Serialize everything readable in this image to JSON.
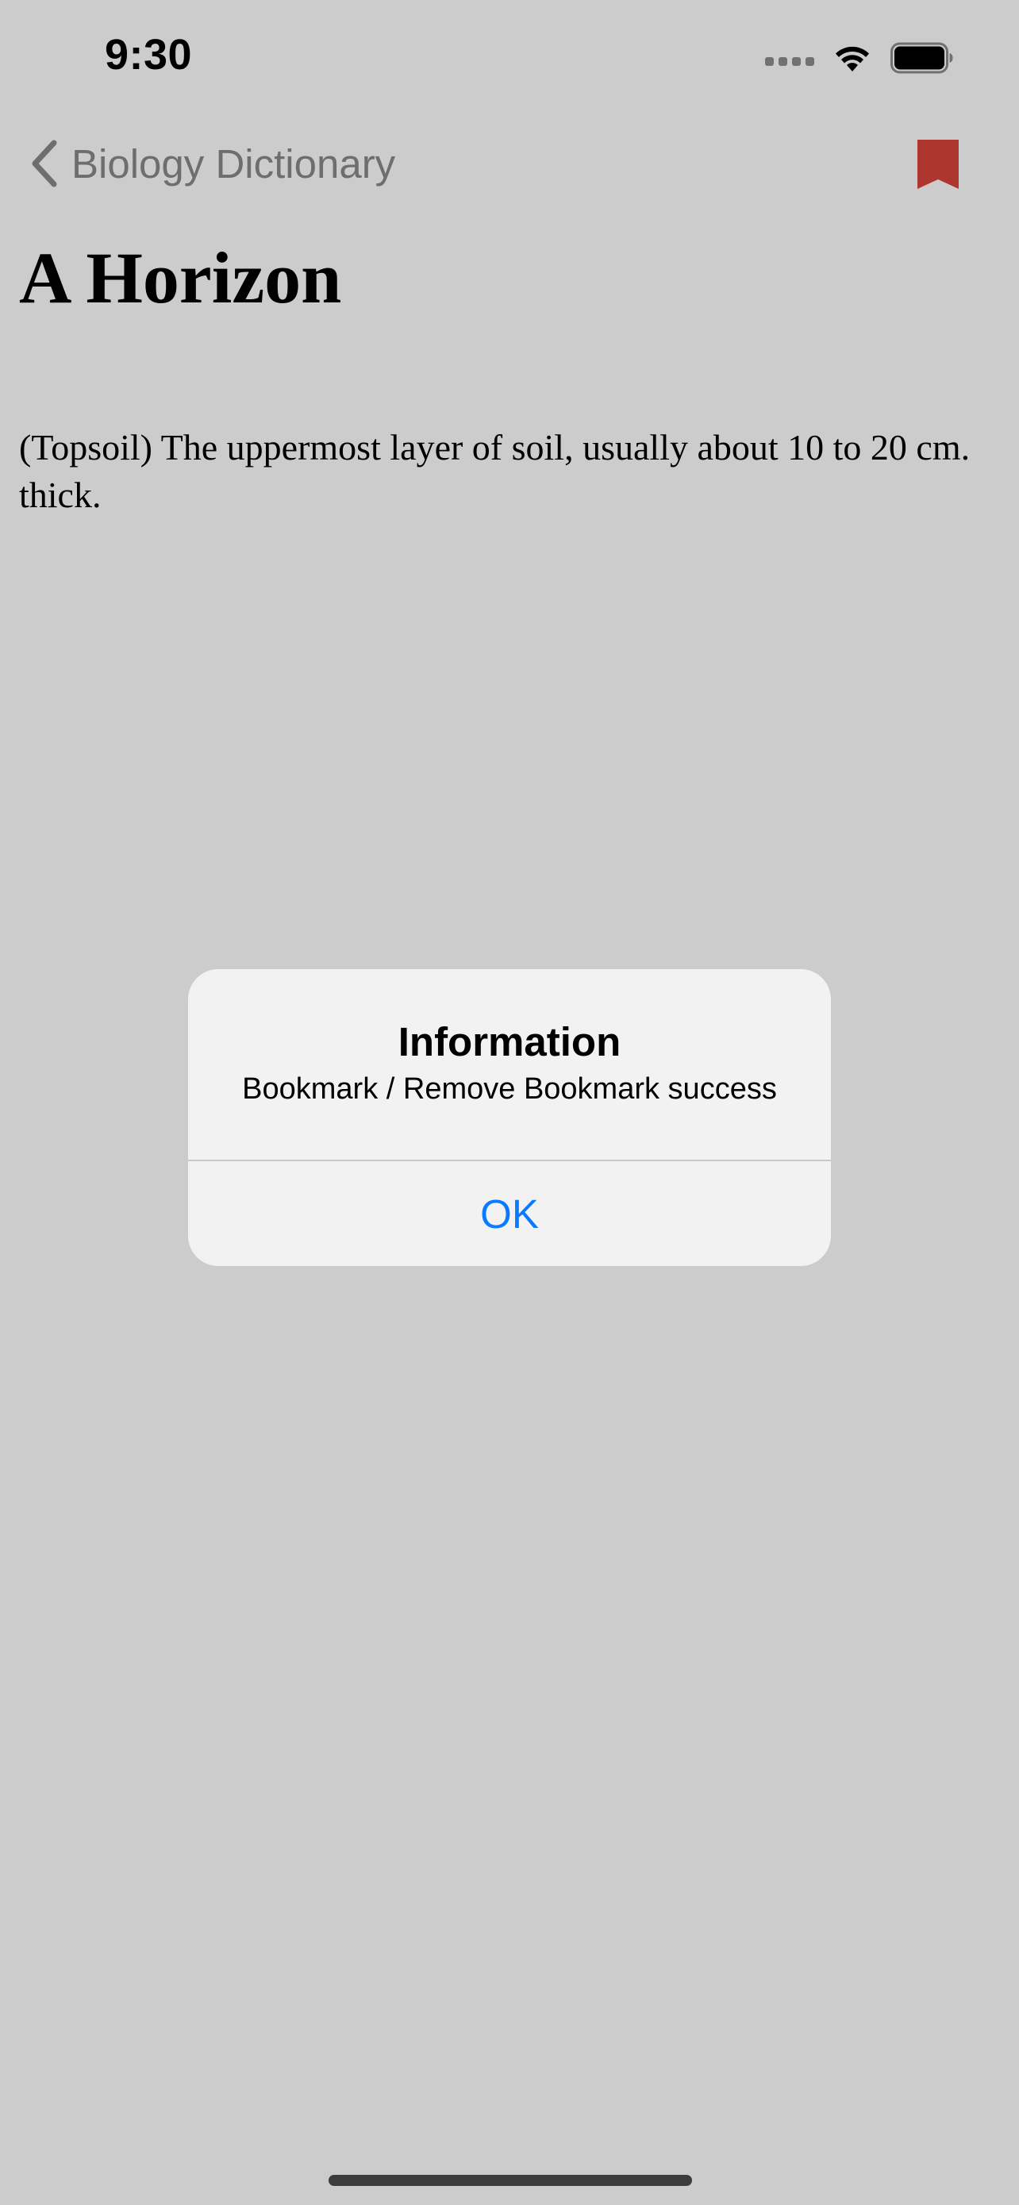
{
  "status_bar": {
    "time": "9:30"
  },
  "nav": {
    "back_label": "Biology Dictionary",
    "back_icon": "chevron-left-icon",
    "bookmark_icon": "bookmark-icon",
    "bookmark_color": "#d9443a"
  },
  "entry": {
    "title": "A Horizon",
    "definition": "(Topsoil) The uppermost layer of soil, usually about 10 to 20 cm. thick."
  },
  "alert": {
    "title": "Information",
    "message": "Bookmark / Remove Bookmark success",
    "ok_label": "OK",
    "button_color": "#0a7aff"
  }
}
